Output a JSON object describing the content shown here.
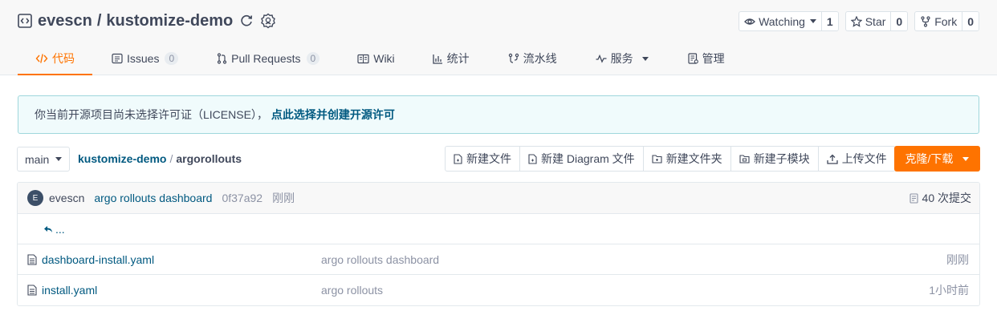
{
  "repo": {
    "owner": "evescn",
    "separator": "/",
    "name": "kustomize-demo"
  },
  "actions": [
    {
      "label": "Watching",
      "count": "1",
      "icon": "eye-icon",
      "dropdown": true
    },
    {
      "label": "Star",
      "count": "0",
      "icon": "star-icon",
      "dropdown": false
    },
    {
      "label": "Fork",
      "count": "0",
      "icon": "fork-icon",
      "dropdown": false
    }
  ],
  "tabs": [
    {
      "label": "代码",
      "icon": "code-icon",
      "active": true
    },
    {
      "label": "Issues",
      "badge": "0",
      "icon": "issues-icon"
    },
    {
      "label": "Pull Requests",
      "badge": "0",
      "icon": "pull-request-icon"
    },
    {
      "label": "Wiki",
      "icon": "book-icon"
    },
    {
      "label": "统计",
      "icon": "bar-chart-icon"
    },
    {
      "label": "流水线",
      "icon": "pipeline-icon"
    },
    {
      "label": "服务",
      "icon": "pulse-icon",
      "dropdown": true
    },
    {
      "label": "管理",
      "icon": "settings-doc-icon"
    }
  ],
  "notice": {
    "text": "你当前开源项目尚未选择许可证（LICENSE），",
    "link": "点此选择并创建开源许可"
  },
  "branch": {
    "name": "main"
  },
  "breadcrumb": {
    "root": "kustomize-demo",
    "slash": "/",
    "current": "argorollouts"
  },
  "file_actions": [
    {
      "label": "新建文件",
      "icon": "new-file-icon"
    },
    {
      "label": "新建 Diagram 文件",
      "icon": "new-diagram-icon"
    },
    {
      "label": "新建文件夹",
      "icon": "new-folder-icon"
    },
    {
      "label": "新建子模块",
      "icon": "submodule-icon"
    },
    {
      "label": "上传文件",
      "icon": "upload-icon"
    }
  ],
  "clone_button": "克隆/下载",
  "latest_commit": {
    "avatar_letter": "E",
    "author": "evescn",
    "message": "argo rollouts dashboard",
    "sha": "0f37a92",
    "time": "刚刚",
    "count": "40 次提交"
  },
  "parent_dir": "...",
  "files": [
    {
      "name": "dashboard-install.yaml",
      "message": "argo rollouts dashboard",
      "time": "刚刚"
    },
    {
      "name": "install.yaml",
      "message": "argo rollouts",
      "time": "1小时前"
    }
  ],
  "colors": {
    "accent": "#fe7300",
    "link": "#005980",
    "notice_border": "#9fd7dc"
  }
}
